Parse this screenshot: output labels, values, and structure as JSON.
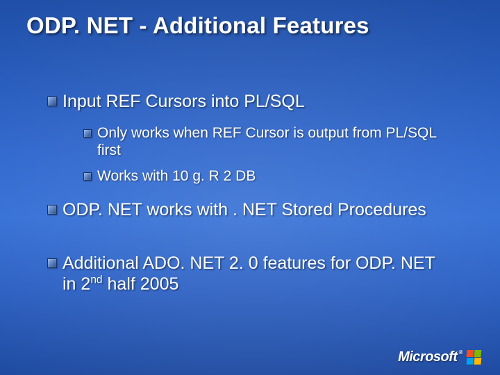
{
  "title": "ODP. NET - Additional Features",
  "bullets": {
    "b1": "Input REF Cursors into PL/SQL",
    "b1a": "Only works when REF Cursor is output from PL/SQL first",
    "b1b": "Works with 10 g. R 2 DB",
    "b2": "ODP. NET works with . NET Stored Procedures",
    "b3_pre": "Additional ADO. NET 2. 0 features for ODP. NET in 2",
    "b3_sup": "nd",
    "b3_post": " half 2005"
  },
  "brand": {
    "name": "Microsoft",
    "tm": "®"
  }
}
